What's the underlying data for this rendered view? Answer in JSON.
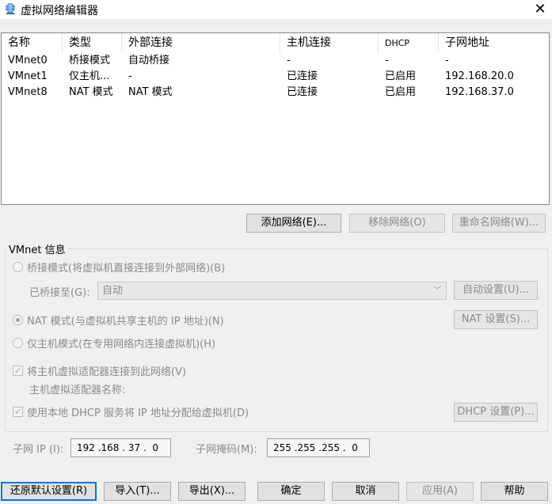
{
  "window": {
    "title": "虚拟网络编辑器",
    "close_symbol": "✕"
  },
  "table": {
    "headers": [
      "名称",
      "类型",
      "外部连接",
      "主机连接",
      "DHCP",
      "子网地址"
    ],
    "rows": [
      [
        "VMnet0",
        "桥接模式",
        "自动桥接",
        "-",
        "-",
        "-"
      ],
      [
        "VMnet1",
        "仅主机...",
        "-",
        "已连接",
        "已启用",
        "192.168.20.0"
      ],
      [
        "VMnet8",
        "NAT 模式",
        "NAT 模式",
        "已连接",
        "已启用",
        "192.168.37.0"
      ]
    ]
  },
  "table_buttons": {
    "add": "添加网络(E)...",
    "remove": "移除网络(O)",
    "rename": "重命名网络(W)..."
  },
  "vmnet_info": {
    "title": "VMnet 信息",
    "bridge_mode": "桥接模式(将虚拟机直接连接到外部网络)(B)",
    "bridged_to_label": "已桥接至(G):",
    "bridged_to_value": "自动",
    "auto_settings": "自动设置(U)...",
    "nat_mode": "NAT 模式(与虚拟机共享主机的 IP 地址)(N)",
    "nat_settings": "NAT 设置(S)...",
    "host_only": "仅主机模式(在专用网络内连接虚拟机)(H)",
    "connect_adapter": "将主机虚拟适配器连接到此网络(V)",
    "adapter_name_label": "主机虚拟适配器名称:",
    "use_dhcp": "使用本地 DHCP 服务将 IP 地址分配给虚拟机(D)",
    "dhcp_settings": "DHCP 设置(P)...",
    "subnet_ip_label": "子网 IP (I):",
    "subnet_ip": "192 .168 . 37 .  0",
    "subnet_mask_label": "子网掩码(M):",
    "subnet_mask": "255 .255 .255 .  0",
    "check_mark": "✓",
    "selected_mode": "nat"
  },
  "footer": {
    "restore": "还原默认设置(R)",
    "import": "导入(T)...",
    "export": "导出(X)...",
    "ok": "确定",
    "cancel": "取消",
    "apply": "应用(A)",
    "help": "帮助"
  }
}
